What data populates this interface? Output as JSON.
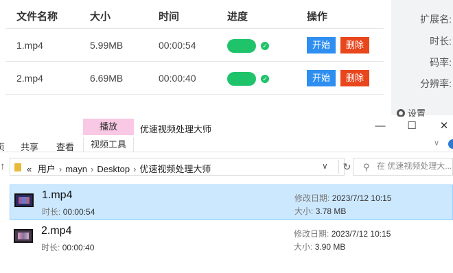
{
  "table": {
    "headers": [
      "文件名称",
      "大小",
      "时间",
      "进度",
      "操作"
    ],
    "rows": [
      {
        "name": "1.mp4",
        "size": "5.99MB",
        "time": "00:00:54",
        "start": "开始",
        "delete": "删除"
      },
      {
        "name": "2.mp4",
        "size": "6.69MB",
        "time": "00:00:40",
        "start": "开始",
        "delete": "删除"
      }
    ]
  },
  "side_panel": {
    "labels": [
      "扩展名:",
      "时长:",
      "码率:",
      "分辨率:"
    ],
    "settings": "设置"
  },
  "explorer": {
    "context_tab": "播放",
    "title": "优速视频处理大师",
    "ribbon_tabs": [
      "共享",
      "查看",
      "视频工具"
    ],
    "ribbon_left_fragment": "页",
    "breadcrumb": [
      "用户",
      "mayn",
      "Desktop",
      "优速视频处理大师"
    ],
    "breadcrumb_prefix": "«",
    "search_placeholder": "在 优速视频处理大...",
    "files": [
      {
        "name": "1.mp4",
        "duration_label": "时长:",
        "duration": "00:00:54",
        "date_label": "修改日期:",
        "date": "2023/7/12 10:15",
        "size_label": "大小:",
        "size": "3.78 MB",
        "selected": true
      },
      {
        "name": "2.mp4",
        "duration_label": "时长:",
        "duration": "00:00:40",
        "date_label": "修改日期:",
        "date": "2023/7/12 10:15",
        "size_label": "大小:",
        "size": "3.90 MB",
        "selected": false
      }
    ]
  },
  "colors": {
    "start_button": "#2f8ff0",
    "delete_button": "#e8461c",
    "progress_toggle": "#1fc36a",
    "selected_row": "#cce8ff",
    "context_tab": "#f8c8e4"
  },
  "icons": [
    "check-icon",
    "gear-icon",
    "folder-icon",
    "refresh-icon",
    "search-icon",
    "up-arrow-icon",
    "chevron-down-icon",
    "minimize-icon",
    "maximize-icon",
    "close-icon",
    "help-icon",
    "video-thumbnail-icon"
  ]
}
